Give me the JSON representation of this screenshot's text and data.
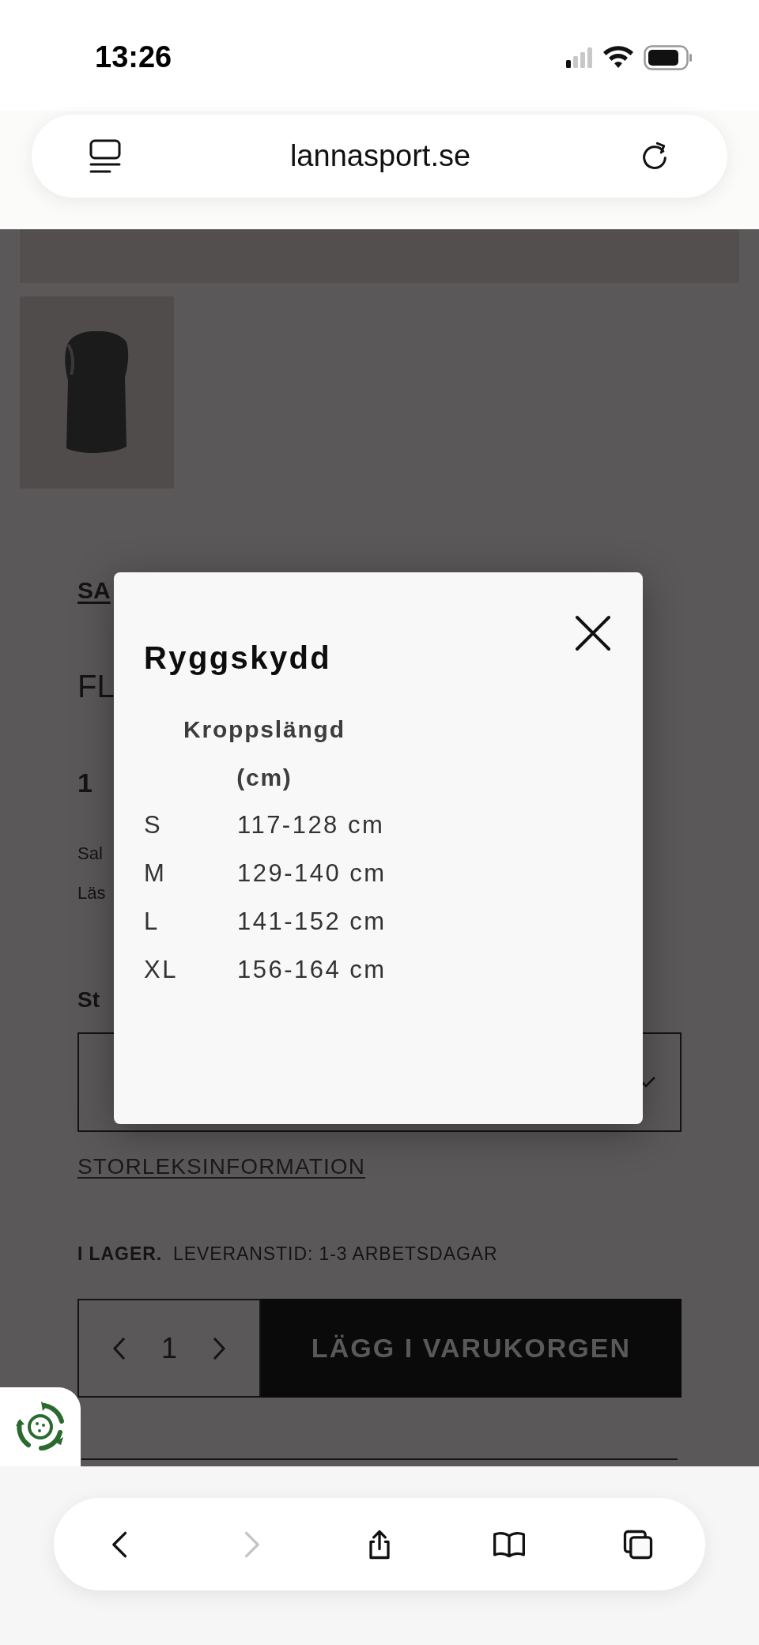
{
  "status_bar": {
    "time": "13:26"
  },
  "browser": {
    "url": "lannasport.se"
  },
  "page": {
    "fragments": [
      {
        "kind": "link",
        "text": "SA"
      },
      {
        "kind": "title",
        "text": "FL"
      },
      {
        "kind": "price",
        "text": "1"
      },
      {
        "kind": "body",
        "text": "Sal"
      },
      {
        "kind": "body",
        "text": "Läs"
      },
      {
        "kind": "label",
        "text": "St"
      }
    ],
    "size_info_link": "STORLEKSINFORMATION",
    "stock": {
      "status": "I LAGER.",
      "delivery": "LEVERANSTID: 1-3 ARBETSDAGAR"
    },
    "quantity": "1",
    "add_to_cart": "LÄGG I VARUKORGEN"
  },
  "modal": {
    "title": "Ryggskydd",
    "column_header": "Kroppslängd (cm)",
    "rows": [
      {
        "size": "S",
        "length": "117-128 cm"
      },
      {
        "size": "M",
        "length": "129-140 cm"
      },
      {
        "size": "L",
        "length": "141-152 cm"
      },
      {
        "size": "XL",
        "length": "156-164 cm"
      }
    ]
  },
  "toolbar": [
    {
      "kind": "back",
      "disabled": false
    },
    {
      "kind": "forward",
      "disabled": true
    },
    {
      "kind": "share",
      "disabled": false
    },
    {
      "kind": "bookmarks",
      "disabled": false
    },
    {
      "kind": "tabs",
      "disabled": false
    }
  ]
}
